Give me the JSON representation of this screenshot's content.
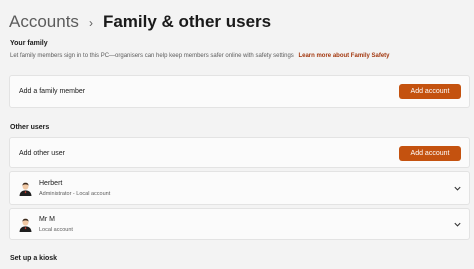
{
  "breadcrumb": {
    "parent": "Accounts",
    "separator": "›",
    "current": "Family & other users"
  },
  "your_family": {
    "title": "Your family",
    "description": "Let family members sign in to this PC—organisers can help keep members safer online with safety settings",
    "link": "Learn more about Family Safety",
    "card_label": "Add a family member",
    "button_label": "Add account"
  },
  "other_users": {
    "title": "Other users",
    "card_label": "Add other user",
    "button_label": "Add account",
    "users": [
      {
        "name": "Herbert",
        "role": "Administrator - Local account",
        "avatar_icon": "user-avatar-icon"
      },
      {
        "name": "Mr M",
        "role": "Local account",
        "avatar_icon": "user-avatar-icon"
      }
    ]
  },
  "kiosk": {
    "title": "Set up a kiosk"
  },
  "colors": {
    "accent": "#c4520f",
    "link": "#a3380f",
    "background": "#f3f3f3",
    "card": "#fbfbfb"
  }
}
